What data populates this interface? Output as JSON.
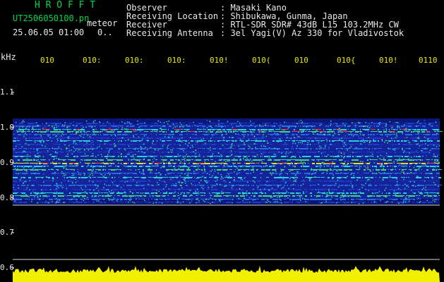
{
  "header": {
    "app_title": "H R O F F T",
    "file_name": "UT2506050100.pn",
    "mode_label": "meteor",
    "datetime": "25.06.05 01:00",
    "count": "0.."
  },
  "info": {
    "observer_label": "Observer",
    "observer_value": ": Masaki Kano",
    "location_label": "Receiving Location",
    "location_value": ": Shibukawa, Gunma, Japan",
    "receiver_label": "Receiver",
    "receiver_value": ": RTL-SDR SDR# 43dB L15 103.2MHz CW",
    "antenna_label": "Receiving Antenna",
    "antenna_value": ": 3el Yagi(V) Az 330 for Vladivostok"
  },
  "axis": {
    "y_unit": "kHz",
    "y_ticks": [
      "1.1",
      "1.0",
      "0.9",
      "0.8",
      "0.7",
      "0.6"
    ],
    "x_ticks": [
      "010",
      "010:",
      "010:",
      "010:",
      "010!",
      "010(",
      "010",
      "010{",
      "010!",
      "0110"
    ]
  },
  "colors": {
    "background": "#000000",
    "header_green": "#00d84a",
    "text_white": "#e8e8e8",
    "axis_yellow": "#e8e800",
    "baseline_yellow": "#f0f000"
  }
}
